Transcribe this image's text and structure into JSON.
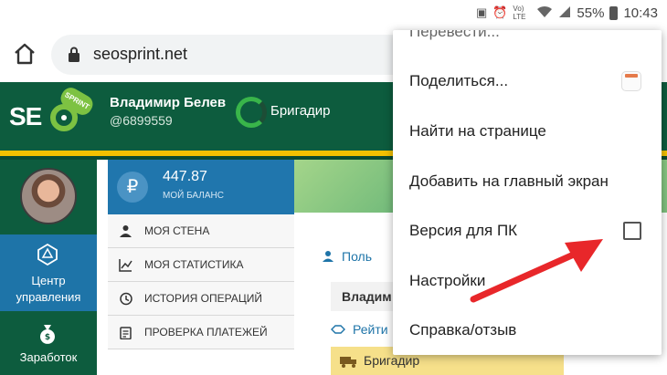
{
  "status_bar": {
    "battery": "55%",
    "time": "10:43",
    "volte": "Vo) LTE",
    "icons": [
      "notification-icon",
      "alarm-icon",
      "volte-icon",
      "wifi-icon",
      "signal-icon",
      "battery-icon"
    ]
  },
  "browser": {
    "url": "seosprint.net"
  },
  "site": {
    "logo_text": "SE",
    "logo_badge": "SPRINT",
    "user_name": "Владимир Белев",
    "user_id": "@6899559",
    "rank": "Бригадир",
    "sidebar": [
      {
        "label": "Центр управления",
        "icon": "dice-icon"
      },
      {
        "label": "Заработок",
        "icon": "money-bag-icon"
      }
    ],
    "balance": {
      "value": "447.87",
      "label": "МОЙ БАЛАНС",
      "currency_symbol": "₽"
    },
    "menu": [
      {
        "label": "МОЯ СТЕНА",
        "icon": "user-icon"
      },
      {
        "label": "МОЯ СТАТИСТИКА",
        "icon": "chart-icon"
      },
      {
        "label": "ИСТОРИЯ ОПЕРАЦИЙ",
        "icon": "history-icon"
      },
      {
        "label": "ПРОВЕРКА ПЛАТЕЖЕЙ",
        "icon": "clipboard-icon"
      }
    ],
    "content": {
      "row1": "Поль",
      "row2": "Владим",
      "row3": "Рейти",
      "row4": "Бригадир"
    }
  },
  "popup_menu": {
    "items": [
      {
        "label": "Перевести..."
      },
      {
        "label": "Поделиться..."
      },
      {
        "label": "Найти на странице"
      },
      {
        "label": "Добавить на главный экран"
      },
      {
        "label": "Версия для ПК",
        "checked": false
      },
      {
        "label": "Настройки"
      },
      {
        "label": "Справка/отзыв"
      }
    ]
  },
  "colors": {
    "header_green": "#0d5c3e",
    "accent_blue": "#1e74a8",
    "accent_yellow": "#f3c000",
    "arrow_red": "#e8272a"
  }
}
